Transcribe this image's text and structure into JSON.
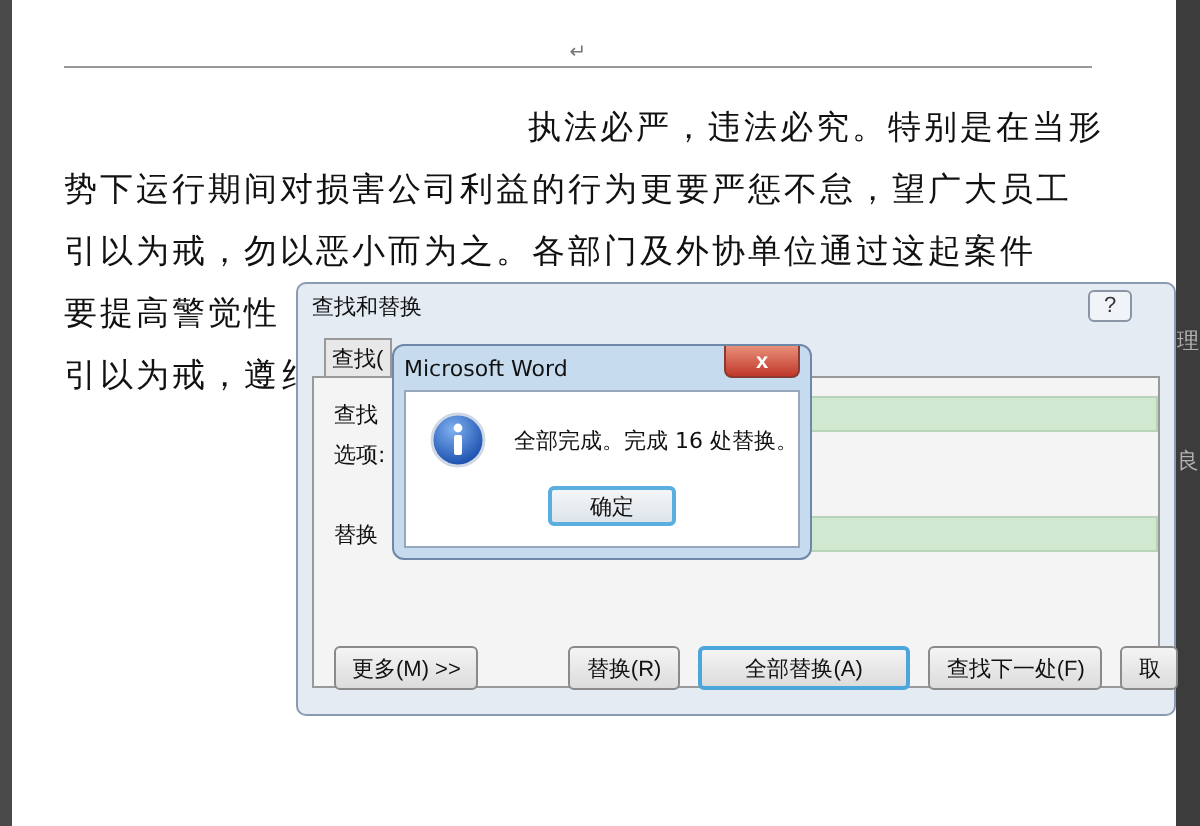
{
  "document": {
    "paragraph_mark": "↵",
    "lines": [
      {
        "text": "执法必严，违法必究。特别是在当形"
      },
      {
        "text": "势下运行期间对损害公司利益的行为更要严惩不怠，望广大员工"
      },
      {
        "text": "引以为戒，勿以恶小而为之。各部门及外协单位通过这起案件"
      },
      {
        "text": "要提高警觉性"
      },
      {
        "text": "引以为戒，遵纟"
      }
    ]
  },
  "side_panel": {
    "texts": [
      "理",
      "良"
    ]
  },
  "find_replace_dialog": {
    "title": "查找和替换",
    "help": "?",
    "tabs": [
      {
        "label": "查找(",
        "selected": false
      }
    ],
    "find_label": "查找",
    "options_label": "选项:",
    "replace_label": "替换",
    "buttons": [
      {
        "label": "更多(M) >>",
        "focused": false
      },
      {
        "label": "替换(R)",
        "focused": false
      },
      {
        "label": "全部替换(A)",
        "focused": true
      },
      {
        "label": "查找下一处(F)",
        "focused": false
      },
      {
        "label": "取",
        "focused": false
      }
    ]
  },
  "message_box": {
    "title": "Microsoft Word",
    "close": "x",
    "message": "全部完成。完成 16 处替换。",
    "ok": "确定"
  }
}
